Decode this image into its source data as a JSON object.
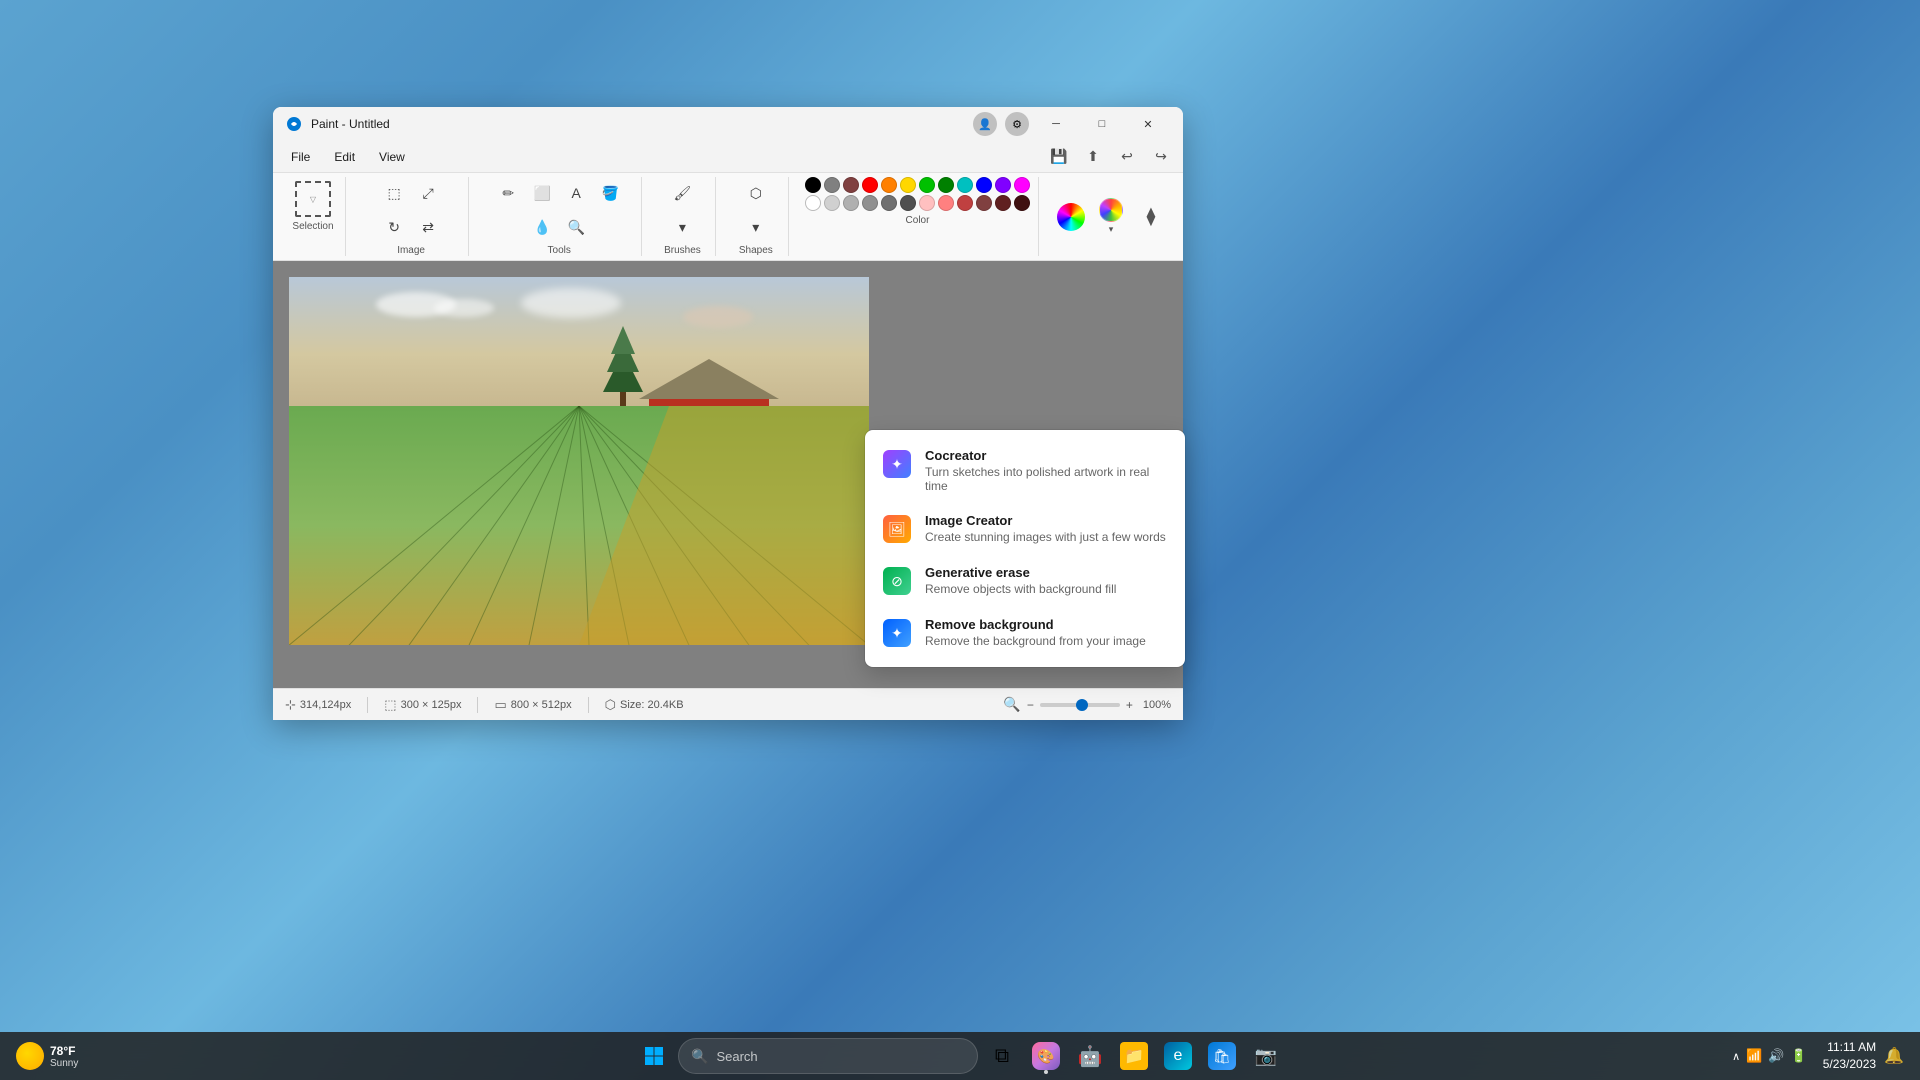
{
  "window": {
    "title": "Paint - Untitled",
    "icon": "🎨"
  },
  "titlebar": {
    "minimize": "─",
    "maximize": "□",
    "close": "✕"
  },
  "menu": {
    "items": [
      "File",
      "Edit",
      "View"
    ],
    "undo_icon": "↩",
    "redo_icon": "↪",
    "save_icon": "💾",
    "share_icon": "⬆",
    "settings_icon": "⚙"
  },
  "ribbon": {
    "selection_label": "Selection",
    "image_label": "Image",
    "tools_label": "Tools",
    "brushes_label": "Brushes",
    "shapes_label": "Shapes",
    "color_label": "Color"
  },
  "colors": {
    "swatches": [
      "#000000",
      "#808080",
      "#c0c0c0",
      "#ffffff",
      "#800000",
      "#ff0000",
      "#ff8040",
      "#ffff00",
      "#008000",
      "#00ff00",
      "#00ffff",
      "#0000ff",
      "#800080",
      "#ff00ff",
      "#8080ff",
      "#8040ff"
    ],
    "row2": [
      "#ffffff",
      "#c8c8c8",
      "#a0a0a0",
      "#787878",
      "#585858",
      "#383838",
      "#181818",
      "#c8a0a0",
      "#c87878",
      "#c85050",
      "#c83030",
      "#c81010"
    ]
  },
  "ai_dropdown": {
    "items": [
      {
        "title": "Cocreator",
        "description": "Turn sketches into polished artwork in real time",
        "icon": "cocreator"
      },
      {
        "title": "Image Creator",
        "description": "Create stunning images with just a few words",
        "icon": "imgcreator"
      },
      {
        "title": "Generative erase",
        "description": "Remove objects with background fill",
        "icon": "generative"
      },
      {
        "title": "Remove background",
        "description": "Remove the background from your image",
        "icon": "rmbg"
      }
    ]
  },
  "statusbar": {
    "coordinates": "314,124px",
    "selection_size": "300 × 125px",
    "canvas_size": "800 × 512px",
    "file_size": "Size: 20.4KB",
    "zoom": "100%",
    "zoom_min": "🔍",
    "zoom_max": "🔍"
  },
  "taskbar": {
    "search_placeholder": "Search",
    "time": "11:11 AM",
    "date": "5/23/2023",
    "weather_temp": "78°F",
    "weather_desc": "Sunny"
  }
}
